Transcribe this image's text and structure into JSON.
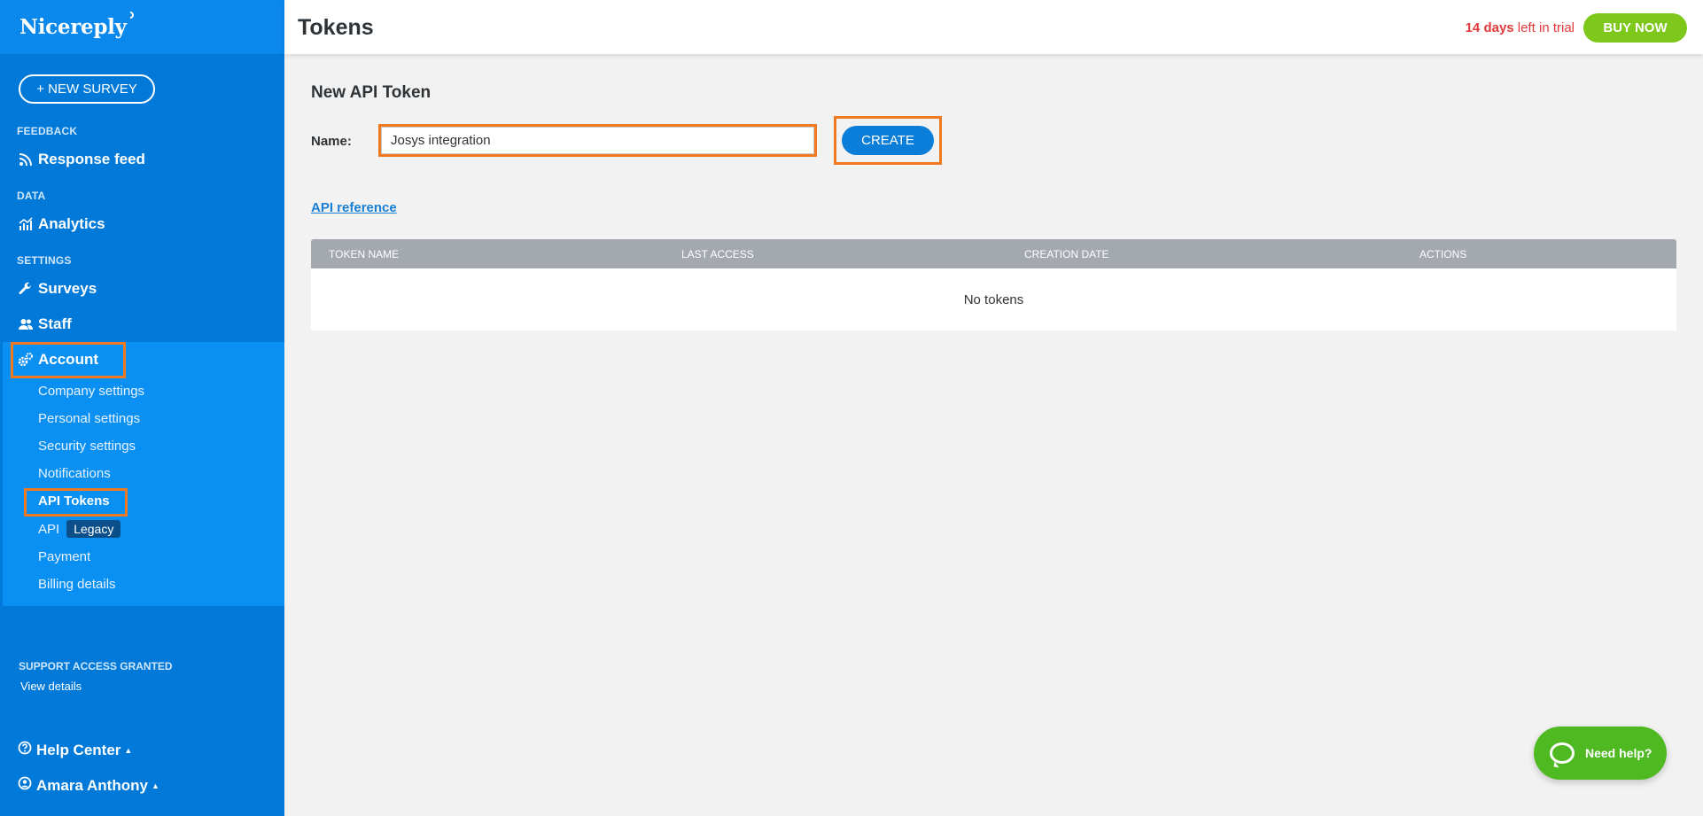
{
  "sidebar": {
    "logo": "Nicereply",
    "new_survey": "+ NEW SURVEY",
    "sections": {
      "feedback": "FEEDBACK",
      "data": "DATA",
      "settings": "SETTINGS"
    },
    "nav": {
      "response_feed": "Response feed",
      "analytics": "Analytics",
      "surveys": "Surveys",
      "staff": "Staff",
      "account": "Account"
    },
    "account_items": [
      {
        "label": "Company settings"
      },
      {
        "label": "Personal settings"
      },
      {
        "label": "Security settings"
      },
      {
        "label": "Notifications"
      },
      {
        "label": "API Tokens"
      },
      {
        "label": "API",
        "badge": "Legacy"
      },
      {
        "label": "Payment"
      },
      {
        "label": "Billing details"
      }
    ],
    "support": {
      "label": "SUPPORT ACCESS GRANTED",
      "link": "View details"
    },
    "help_center": "Help Center",
    "user_name": "Amara Anthony"
  },
  "header": {
    "title": "Tokens",
    "trial_days": "14 days",
    "trial_suffix": " left in trial",
    "buy_now": "BUY NOW"
  },
  "form": {
    "title": "New API Token",
    "name_label": "Name:",
    "name_value": "Josys integration",
    "create_label": "CREATE"
  },
  "api_reference": "API reference",
  "table": {
    "columns": [
      "TOKEN NAME",
      "LAST ACCESS",
      "CREATION DATE",
      "ACTIONS"
    ],
    "empty": "No tokens"
  },
  "need_help": "Need help?",
  "colors": {
    "sidebar": "#0079d8",
    "accent": "#0a7ed8",
    "highlight": "#f07a21",
    "buy_now": "#7dc81a",
    "trial": "#e23b3b"
  }
}
